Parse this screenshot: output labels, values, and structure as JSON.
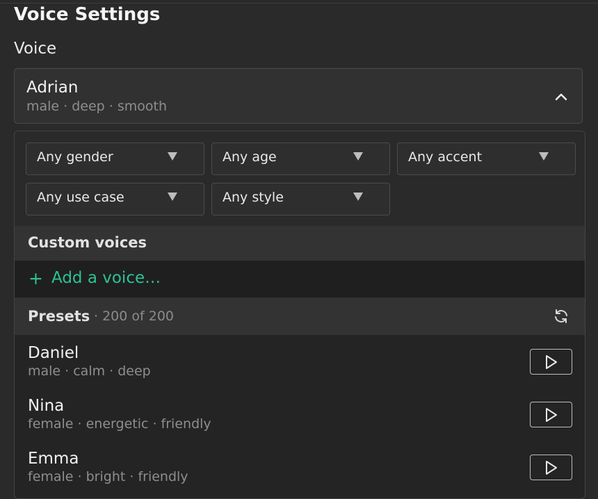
{
  "page": {
    "title": "Voice Settings",
    "voice_label": "Voice"
  },
  "selected": {
    "name": "Adrian",
    "tags": "male · deep · smooth"
  },
  "filters": [
    {
      "label": "Any gender"
    },
    {
      "label": "Any age"
    },
    {
      "label": "Any accent"
    },
    {
      "label": "Any use case"
    },
    {
      "label": "Any style"
    }
  ],
  "custom": {
    "header": "Custom voices",
    "add_label": "Add a voice…",
    "add_glyph": "+"
  },
  "presets": {
    "header": "Presets",
    "count": "· 200 of 200",
    "voices": [
      {
        "name": "Daniel",
        "tags": "male · calm · deep"
      },
      {
        "name": "Nina",
        "tags": "female · energetic · friendly"
      },
      {
        "name": "Emma",
        "tags": "female · bright · friendly"
      }
    ]
  },
  "colors": {
    "accent": "#2cc294",
    "background": "#2a2a2a",
    "panel": "#242424"
  },
  "icons": {
    "dropdown": "chevron-up-icon",
    "refresh": "refresh-icon",
    "play": "play-icon",
    "filter": "caret-down-icon"
  }
}
